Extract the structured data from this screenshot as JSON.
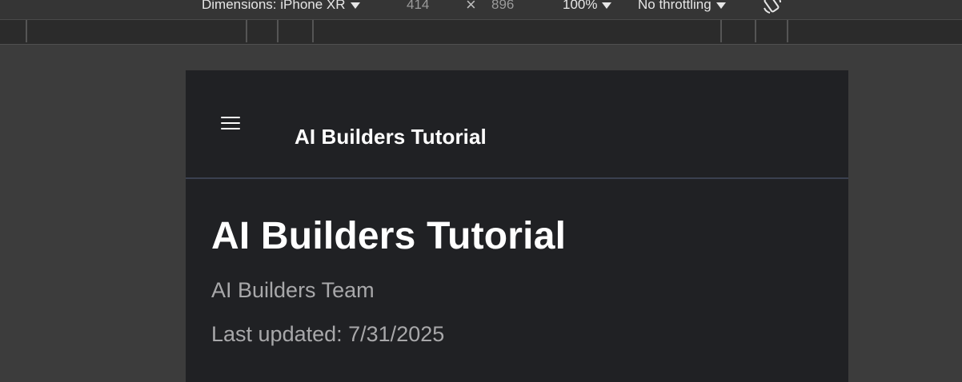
{
  "devtools_toolbar": {
    "dimensions_label": "Dimensions: iPhone XR",
    "width_value": "414",
    "times_symbol": "×",
    "height_value": "896",
    "zoom_label": "100%",
    "throttling_label": "No throttling",
    "rotate_icon": "rotate-device-icon"
  },
  "app": {
    "menu_icon": "hamburger-menu-icon",
    "header_title": "AI Builders Tutorial",
    "page_title": "AI Builders Tutorial",
    "author": "AI Builders Team",
    "last_updated": "Last updated: 7/31/2025"
  },
  "colors": {
    "devtools_bg": "#3c3c3c",
    "page_bg": "#202124",
    "text_primary": "#ffffff",
    "text_secondary": "#a8a8aa",
    "header_divider": "#3a4050"
  }
}
